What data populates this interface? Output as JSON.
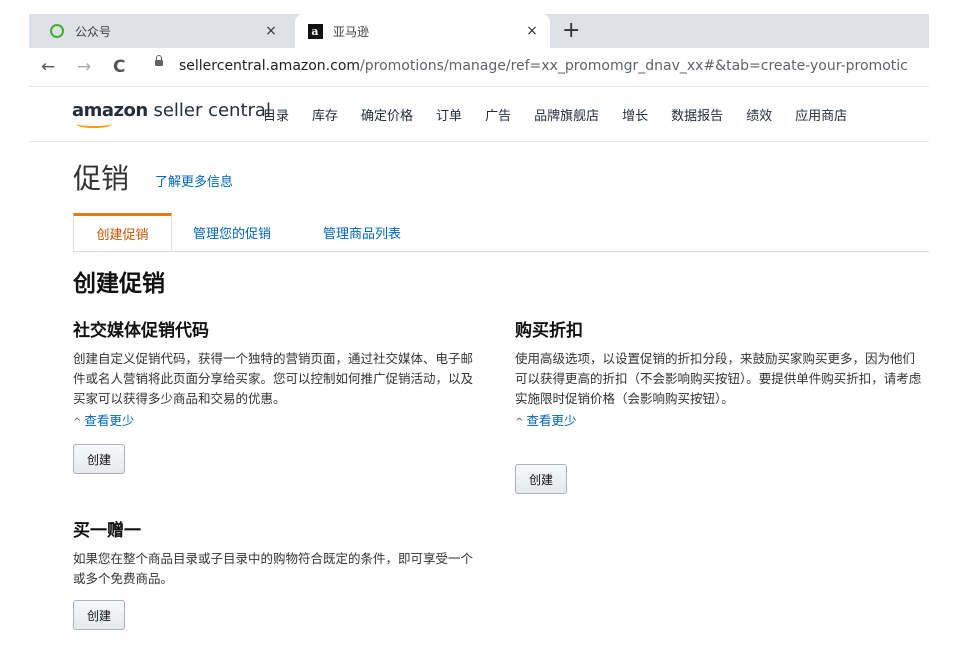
{
  "browser": {
    "tabs": [
      {
        "label": "公众号",
        "icon": "wechat-icon",
        "close": "×"
      },
      {
        "label": "亚马逊",
        "icon": "amazon-icon",
        "close": "×"
      }
    ],
    "new_tab": "+",
    "nav": {
      "back": "←",
      "forward": "→",
      "reload": "C"
    },
    "url_host": "sellercentral.amazon.com",
    "url_path": "/promotions/manage/ref=xx_promomgr_dnav_xx#&tab=create-your-promotic"
  },
  "header": {
    "brand_bold": "amazon",
    "brand_rest": " seller central",
    "menu": [
      "目录",
      "库存",
      "确定价格",
      "订单",
      "广告",
      "品牌旗舰店",
      "增长",
      "数据报告",
      "绩效",
      "应用商店"
    ]
  },
  "page": {
    "title": "促销",
    "learn_more": "了解更多信息",
    "tabs": [
      "创建促销",
      "管理您的促销",
      "管理商品列表"
    ],
    "heading": "创建促销",
    "cards": {
      "social": {
        "title": "社交媒体促销代码",
        "desc": "创建自定义促销代码，获得一个独特的营销页面，通过社交媒体、电子邮件或名人营销将此页面分享给买家。您可以控制如何推广促销活动，以及买家可以获得多少商品和交易的优惠。",
        "more": "查看更少",
        "button": "创建"
      },
      "discount": {
        "title": "购买折扣",
        "desc": "使用高级选项，以设置促销的折扣分段，来鼓励买家购买更多，因为他们可以获得更高的折扣（不会影响购买按钮）。要提供单件购买折扣，请考虑实施限时促销价格（会影响购买按钮）。",
        "more": "查看更少",
        "button": "创建"
      },
      "bogo": {
        "title": "买一赠一",
        "desc": "如果您在整个商品目录或子目录中的购物符合既定的条件，即可享受一个或多个免费商品。",
        "button": "创建"
      }
    }
  },
  "colors": {
    "link": "#0066c0",
    "accent": "#e47911",
    "brand_smile": "#ff9900"
  }
}
